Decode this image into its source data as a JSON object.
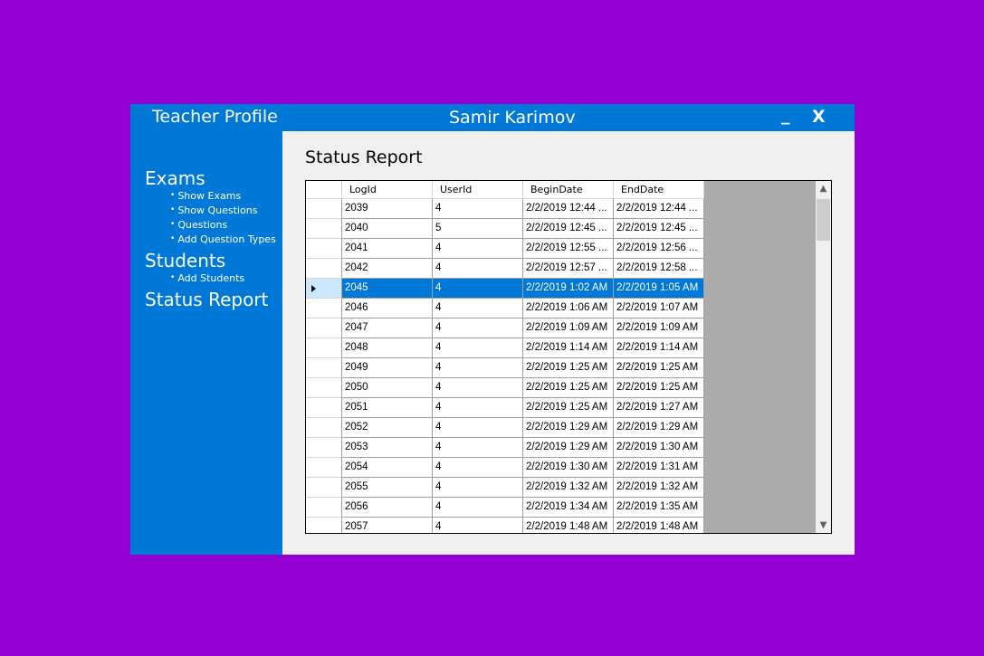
{
  "window": {
    "app_title": "Teacher Profile",
    "user_name": "Samir Karimov",
    "minimize_label": "_",
    "close_label": "X"
  },
  "sidebar": {
    "exams": {
      "label": "Exams",
      "items": [
        {
          "label": "Show Exams"
        },
        {
          "label": "Show Questions"
        },
        {
          "label": "Questions"
        },
        {
          "label": "Add Question Types"
        }
      ]
    },
    "students": {
      "label": "Students",
      "items": [
        {
          "label": "Add Students"
        }
      ]
    },
    "status_report": {
      "label": "Status Report"
    },
    "bullet": "•"
  },
  "main": {
    "title": "Status Report"
  },
  "grid": {
    "columns": [
      "LogId",
      "UserId",
      "BeginDate",
      "EndDate"
    ],
    "selected_index": 4,
    "rows": [
      [
        "2039",
        "4",
        "2/2/2019 12:44 ...",
        "2/2/2019 12:44 ..."
      ],
      [
        "2040",
        "5",
        "2/2/2019 12:45 ...",
        "2/2/2019 12:45 ..."
      ],
      [
        "2041",
        "4",
        "2/2/2019 12:55 ...",
        "2/2/2019 12:56 ..."
      ],
      [
        "2042",
        "4",
        "2/2/2019 12:57 ...",
        "2/2/2019 12:58 ..."
      ],
      [
        "2045",
        "4",
        "2/2/2019 1:02 AM",
        "2/2/2019 1:05 AM"
      ],
      [
        "2046",
        "4",
        "2/2/2019 1:06 AM",
        "2/2/2019 1:07 AM"
      ],
      [
        "2047",
        "4",
        "2/2/2019 1:09 AM",
        "2/2/2019 1:09 AM"
      ],
      [
        "2048",
        "4",
        "2/2/2019 1:14 AM",
        "2/2/2019 1:14 AM"
      ],
      [
        "2049",
        "4",
        "2/2/2019 1:25 AM",
        "2/2/2019 1:25 AM"
      ],
      [
        "2050",
        "4",
        "2/2/2019 1:25 AM",
        "2/2/2019 1:25 AM"
      ],
      [
        "2051",
        "4",
        "2/2/2019 1:25 AM",
        "2/2/2019 1:27 AM"
      ],
      [
        "2052",
        "4",
        "2/2/2019 1:29 AM",
        "2/2/2019 1:29 AM"
      ],
      [
        "2053",
        "4",
        "2/2/2019 1:29 AM",
        "2/2/2019 1:30 AM"
      ],
      [
        "2054",
        "4",
        "2/2/2019 1:30 AM",
        "2/2/2019 1:31 AM"
      ],
      [
        "2055",
        "4",
        "2/2/2019 1:32 AM",
        "2/2/2019 1:32 AM"
      ],
      [
        "2056",
        "4",
        "2/2/2019 1:34 AM",
        "2/2/2019 1:35 AM"
      ],
      [
        "2057",
        "4",
        "2/2/2019 1:48 AM",
        "2/2/2019 1:48 AM"
      ]
    ],
    "scroll_up": "▲",
    "scroll_down": "▼"
  },
  "colors": {
    "background": "#9400d3",
    "accent": "#0078d7",
    "selected_row": "#0078d7",
    "window_body": "#f0f0f0",
    "grid_empty": "#ababab"
  }
}
